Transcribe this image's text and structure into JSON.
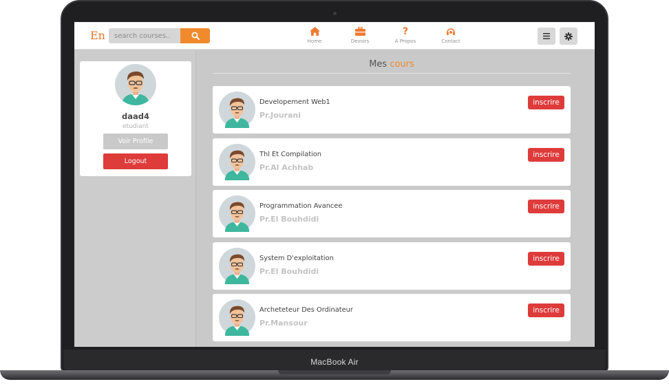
{
  "device": {
    "label": "MacBook Air"
  },
  "header": {
    "logo": "En",
    "search_placeholder": "search courses..",
    "nav": [
      {
        "label": "Home",
        "icon": "home-icon"
      },
      {
        "label": "Devoirs",
        "icon": "briefcase-icon"
      },
      {
        "label": "A Propos",
        "icon": "question-icon"
      },
      {
        "label": "Contact",
        "icon": "headset-icon"
      }
    ]
  },
  "profile": {
    "username": "daad4",
    "role": "etudiant",
    "view_profile_label": "Voir Profile",
    "logout_label": "Logout"
  },
  "main": {
    "title_prefix": "Mes",
    "title_accent": "cours",
    "courses": [
      {
        "name": "Developement Web1",
        "professor": "Pr.Jourani",
        "action": "inscrire"
      },
      {
        "name": "Thl Et Compilation",
        "professor": "Pr.Al Achhab",
        "action": "inscrire"
      },
      {
        "name": "Programmation Avancee",
        "professor": "Pr.El Bouhdidi",
        "action": "inscrire"
      },
      {
        "name": "System D'exploitation",
        "professor": "Pr.El Bouhdidi",
        "action": "inscrire"
      },
      {
        "name": "Archeteteur Des Ordinateur",
        "professor": "Pr.Mansour",
        "action": "inscrire"
      }
    ]
  },
  "colors": {
    "accent": "#f08a2d",
    "danger": "#de3b3b",
    "panel": "#cccccc"
  }
}
